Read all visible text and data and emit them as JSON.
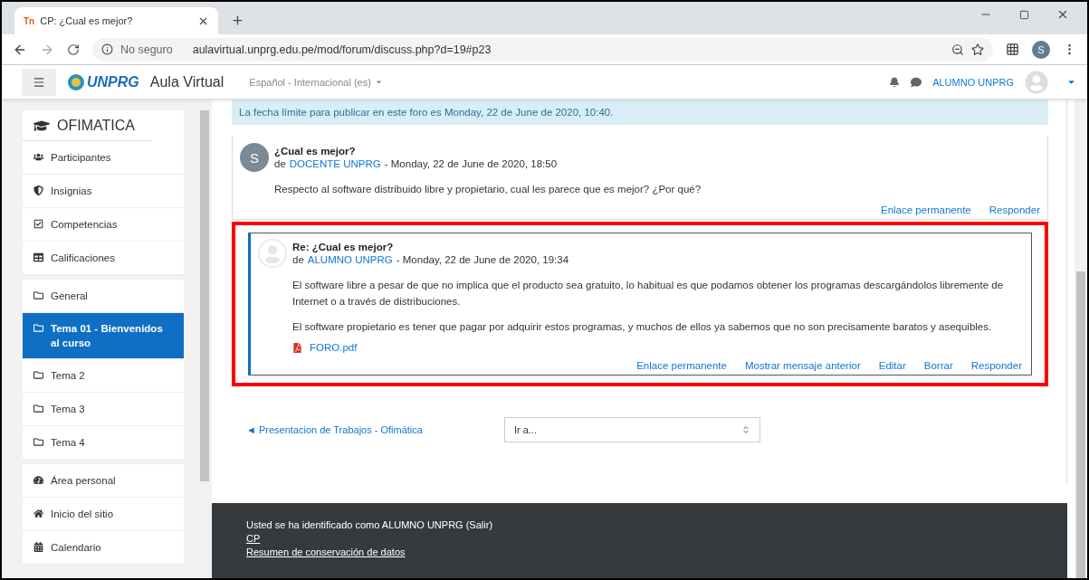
{
  "browser": {
    "favicon_text": "Tn",
    "tab_title": "CP: ¿Cual es mejor?",
    "security": "No seguro",
    "url": "aulavirtual.unprg.edu.pe/mod/forum/discuss.php?d=19#p23",
    "profile_initial": "S"
  },
  "navbar": {
    "logo_text": "UNPRG",
    "site_name": "Aula Virtual",
    "language": "Español - Internacional (es)",
    "user_name": "ALUMNO UNPRG"
  },
  "sidebar": {
    "course": "OFIMATICA",
    "groups": [
      {
        "items": [
          {
            "label": "Participantes",
            "selected": false
          },
          {
            "label": "Insignias",
            "selected": false
          },
          {
            "label": "Competencias",
            "selected": false
          },
          {
            "label": "Calificaciones",
            "selected": false
          }
        ]
      },
      {
        "items": [
          {
            "label": "General",
            "selected": false
          },
          {
            "label": "Tema 01 - Bienvenidos al curso",
            "selected": true
          },
          {
            "label": "Tema 2",
            "selected": false
          },
          {
            "label": "Tema 3",
            "selected": false
          },
          {
            "label": "Tema 4",
            "selected": false
          }
        ]
      },
      {
        "items": [
          {
            "label": "Área personal",
            "selected": false
          },
          {
            "label": "Inicio del sitio",
            "selected": false
          },
          {
            "label": "Calendario",
            "selected": false
          }
        ]
      }
    ]
  },
  "alert": "La fecha límite para publicar en este foro es Monday, 22 de June de 2020, 10:40.",
  "posts": [
    {
      "kind": "discussion",
      "avatar_initial": "S",
      "subject": "¿Cual es mejor?",
      "by": "de",
      "author": "DOCENTE UNPRG",
      "date": "- Monday, 22 de June de 2020, 18:50",
      "paragraphs": [
        "Respecto al software distribuido libre y propietario, cual les parece que es mejor? ¿Por qué?"
      ],
      "actions": [
        "Enlace permanente",
        "Responder"
      ]
    },
    {
      "kind": "reply",
      "highlighted": true,
      "subject": "Re: ¿Cual es mejor?",
      "by": "de",
      "author": "ALUMNO UNPRG",
      "date": "- Monday, 22 de June de 2020, 19:34",
      "paragraphs": [
        "El software libre a pesar de que no implica que el producto sea gratuito, lo habitual es que podamos obtener los programas descargándolos libremente de Internet o a través de distribuciones.",
        "El software propietario es tener que pagar por adquirir estos programas, y muchos de ellos ya sabemos que no son precisamente baratos y asequibles."
      ],
      "attachment": "FORO.pdf",
      "actions": [
        "Enlace permanente",
        "Mostrar mensaje anterior",
        "Editar",
        "Borrar",
        "Responder"
      ]
    }
  ],
  "navigation": {
    "previous": "◄ Presentacion de Trabajos - Ofimática",
    "jump": "Ir a..."
  },
  "footer": {
    "login_info": "Usted se ha identificado como ALUMNO UNPRG (Salir)",
    "course_link": "CP",
    "data_link": "Resumen de conservación de datos"
  }
}
